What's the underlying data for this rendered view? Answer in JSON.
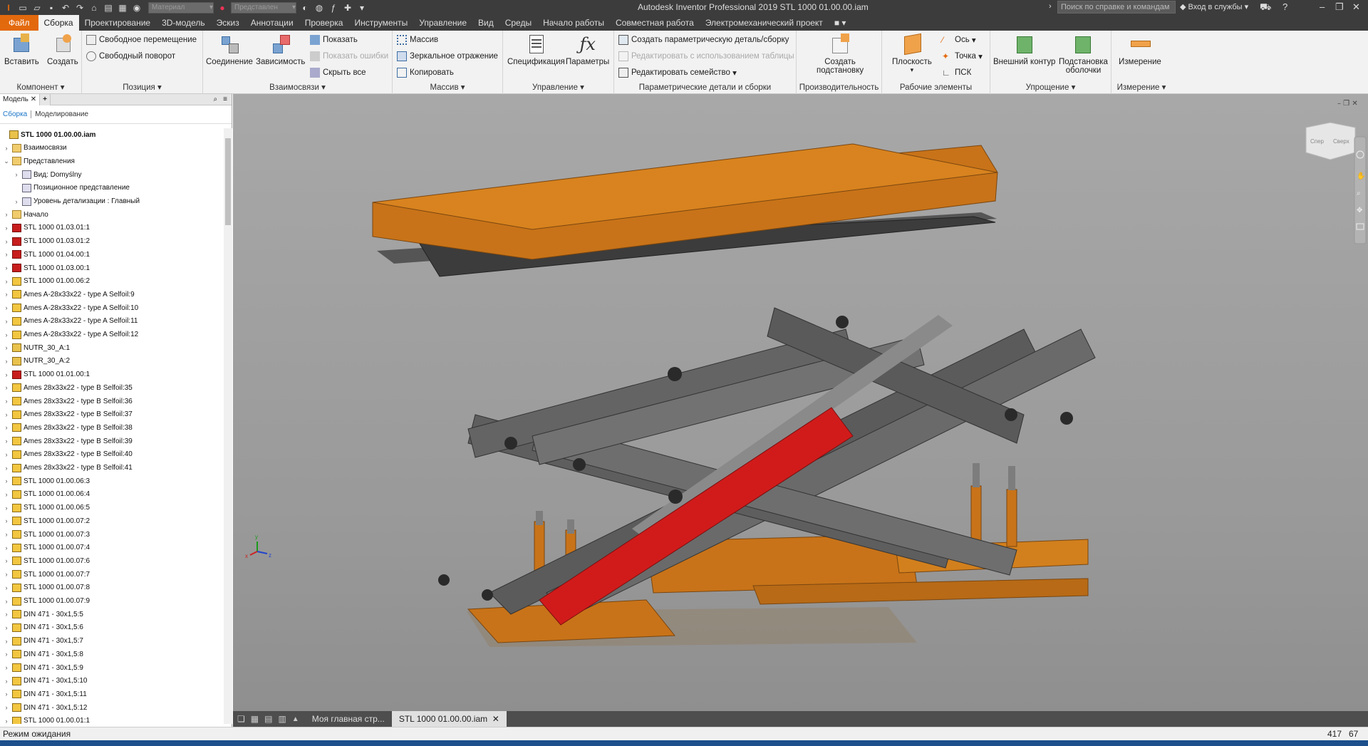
{
  "app": {
    "title": "Autodesk Inventor Professional 2019   STL 1000 01.00.00.iam",
    "material": "Материал",
    "appearance": "Представлен",
    "help_search": "Поиск по справке и командам",
    "signin": "Вход в службы"
  },
  "menu": [
    "Файл",
    "Сборка",
    "Проектирование",
    "3D-модель",
    "Эскиз",
    "Аннотации",
    "Проверка",
    "Инструменты",
    "Управление",
    "Вид",
    "Среды",
    "Начало работы",
    "Совместная работа",
    "Электромеханический проект"
  ],
  "ribbon": {
    "component": {
      "title": "Компонент",
      "insert": "Вставить",
      "create": "Создать"
    },
    "position": {
      "title": "Позиция",
      "free_move": "Свободное перемещение",
      "free_rotate": "Свободный поворот"
    },
    "relations": {
      "title": "Взаимосвязи",
      "joint": "Соединение",
      "constraint": "Зависимость",
      "show": "Показать",
      "show_errors": "Показать ошибки",
      "hide_all": "Скрыть все"
    },
    "pattern": {
      "title": "Массив",
      "pattern": "Массив",
      "mirror": "Зеркальное отражение",
      "copy": "Копировать"
    },
    "manage": {
      "title": "Управление",
      "bom": "Спецификация",
      "params": "Параметры"
    },
    "ipart": {
      "title": "Параметрические детали и сборки",
      "create": "Создать параметрическую деталь/сборку",
      "edit_table": "Редактировать с использованием таблицы",
      "edit_family": "Редактировать семейство"
    },
    "productivity": {
      "title": "Производительность",
      "substitute1": "Создать",
      "substitute2": "подстановку"
    },
    "workfeatures": {
      "title": "Рабочие элементы",
      "plane": "Плоскость",
      "axis": "Ось",
      "point": "Точка",
      "ucs": "ПСК"
    },
    "simplify": {
      "title": "Упрощение",
      "shrinkwrap": "Внешний контур",
      "substitute1": "Подстановка",
      "substitute2": "оболочки"
    },
    "measure": {
      "title": "Измерение",
      "measure": "Измерение"
    }
  },
  "browser": {
    "panel": "Модель",
    "tab_assembly": "Сборка",
    "tab_modeling": "Моделирование",
    "nodes": [
      {
        "label": "STL 1000 01.00.00.iam",
        "icon": "asm",
        "level": 0,
        "exp": ""
      },
      {
        "label": "Взаимосвязи",
        "icon": "folder",
        "level": 1,
        "exp": "›"
      },
      {
        "label": "Представления",
        "icon": "folder",
        "level": 1,
        "exp": "⌄"
      },
      {
        "label": "Вид: Domyślny",
        "icon": "view",
        "level": 2,
        "exp": "›"
      },
      {
        "label": "Позиционное представление",
        "icon": "pos",
        "level": 2,
        "exp": ""
      },
      {
        "label": "Уровень детализации : Главный",
        "icon": "lod",
        "level": 2,
        "exp": "›"
      },
      {
        "label": "Начало",
        "icon": "folder",
        "level": 1,
        "exp": "›"
      },
      {
        "label": "STL 1000 01.03.01:1",
        "icon": "asmred",
        "level": 1,
        "exp": "›"
      },
      {
        "label": "STL 1000 01.03.01:2",
        "icon": "asmred",
        "level": 1,
        "exp": "›"
      },
      {
        "label": "STL 1000 01.04.00:1",
        "icon": "asmred",
        "level": 1,
        "exp": "›"
      },
      {
        "label": "STL 1000 01.03.00:1",
        "icon": "asmred",
        "level": 1,
        "exp": "›"
      },
      {
        "label": "STL 1000 01.00.06:2",
        "icon": "part",
        "level": 1,
        "exp": "›"
      },
      {
        "label": "Ames A-28x33x22 - type A Selfoil:9",
        "icon": "part",
        "level": 1,
        "exp": "›"
      },
      {
        "label": "Ames A-28x33x22 - type A Selfoil:10",
        "icon": "part",
        "level": 1,
        "exp": "›"
      },
      {
        "label": "Ames A-28x33x22 - type A Selfoil:11",
        "icon": "part",
        "level": 1,
        "exp": "›"
      },
      {
        "label": "Ames A-28x33x22 - type A Selfoil:12",
        "icon": "part",
        "level": 1,
        "exp": "›"
      },
      {
        "label": "NUTR_30_A:1",
        "icon": "asm",
        "level": 1,
        "exp": "›"
      },
      {
        "label": "NUTR_30_A:2",
        "icon": "asm",
        "level": 1,
        "exp": "›"
      },
      {
        "label": "STL 1000 01.01.00:1",
        "icon": "asmred",
        "level": 1,
        "exp": "›"
      },
      {
        "label": "Ames 28x33x22 - type B Selfoil:35",
        "icon": "part",
        "level": 1,
        "exp": "›"
      },
      {
        "label": "Ames 28x33x22 - type B Selfoil:36",
        "icon": "part",
        "level": 1,
        "exp": "›"
      },
      {
        "label": "Ames 28x33x22 - type B Selfoil:37",
        "icon": "part",
        "level": 1,
        "exp": "›"
      },
      {
        "label": "Ames 28x33x22 - type B Selfoil:38",
        "icon": "part",
        "level": 1,
        "exp": "›"
      },
      {
        "label": "Ames 28x33x22 - type B Selfoil:39",
        "icon": "part",
        "level": 1,
        "exp": "›"
      },
      {
        "label": "Ames 28x33x22 - type B Selfoil:40",
        "icon": "part",
        "level": 1,
        "exp": "›"
      },
      {
        "label": "Ames 28x33x22 - type B Selfoil:41",
        "icon": "part",
        "level": 1,
        "exp": "›"
      },
      {
        "label": "STL 1000 01.00.06:3",
        "icon": "part",
        "level": 1,
        "exp": "›"
      },
      {
        "label": "STL 1000 01.00.06:4",
        "icon": "part",
        "level": 1,
        "exp": "›"
      },
      {
        "label": "STL 1000 01.00.06:5",
        "icon": "part",
        "level": 1,
        "exp": "›"
      },
      {
        "label": "STL 1000 01.00.07:2",
        "icon": "part",
        "level": 1,
        "exp": "›"
      },
      {
        "label": "STL 1000 01.00.07:3",
        "icon": "part",
        "level": 1,
        "exp": "›"
      },
      {
        "label": "STL 1000 01.00.07:4",
        "icon": "part",
        "level": 1,
        "exp": "›"
      },
      {
        "label": "STL 1000 01.00.07:6",
        "icon": "part",
        "level": 1,
        "exp": "›"
      },
      {
        "label": "STL 1000 01.00.07:7",
        "icon": "part",
        "level": 1,
        "exp": "›"
      },
      {
        "label": "STL 1000 01.00.07:8",
        "icon": "part",
        "level": 1,
        "exp": "›"
      },
      {
        "label": "STL 1000 01.00.07:9",
        "icon": "part",
        "level": 1,
        "exp": "›"
      },
      {
        "label": "DIN 471 - 30x1,5:5",
        "icon": "part",
        "level": 1,
        "exp": "›"
      },
      {
        "label": "DIN 471 - 30x1,5:6",
        "icon": "part",
        "level": 1,
        "exp": "›"
      },
      {
        "label": "DIN 471 - 30x1,5:7",
        "icon": "part",
        "level": 1,
        "exp": "›"
      },
      {
        "label": "DIN 471 - 30x1,5:8",
        "icon": "part",
        "level": 1,
        "exp": "›"
      },
      {
        "label": "DIN 471 - 30x1,5:9",
        "icon": "part",
        "level": 1,
        "exp": "›"
      },
      {
        "label": "DIN 471 - 30x1,5:10",
        "icon": "part",
        "level": 1,
        "exp": "›"
      },
      {
        "label": "DIN 471 - 30x1,5:11",
        "icon": "part",
        "level": 1,
        "exp": "›"
      },
      {
        "label": "DIN 471 - 30x1,5:12",
        "icon": "part",
        "level": 1,
        "exp": "›"
      },
      {
        "label": "STL 1000 01.00.01:1",
        "icon": "part",
        "level": 1,
        "exp": "›"
      }
    ]
  },
  "viewcube": {
    "left": "Спер",
    "right": "Сверх"
  },
  "doctabs": {
    "home": "Моя главная стр...",
    "doc": "STL 1000 01.00.00.iam"
  },
  "status": {
    "text": "Режим ожидания",
    "n1": "417",
    "n2": "67"
  },
  "colors": {
    "accent": "#e3690d",
    "frame": "#3c3c3c",
    "model_orange": "#c87319",
    "cylinder_red": "#d11b1b"
  }
}
